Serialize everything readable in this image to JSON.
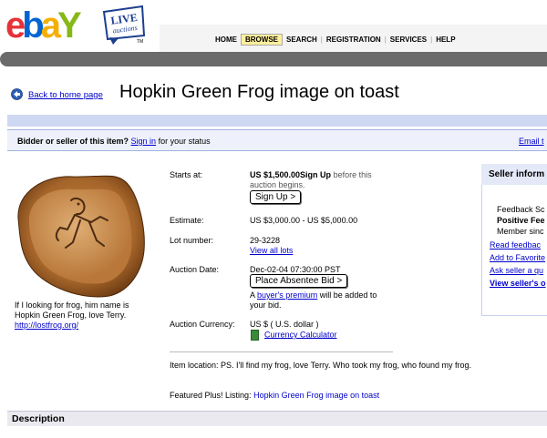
{
  "header": {
    "logo_letters": [
      "e",
      "b",
      "a",
      "Y"
    ],
    "logo_colors": [
      "#e53238",
      "#0064d2",
      "#f5af02",
      "#86b817"
    ],
    "live_badge": [
      "LIVE",
      "auctions"
    ],
    "live_tm": "TM",
    "nav": [
      "HOME",
      "BROWSE",
      "SEARCH",
      "REGISTRATION",
      "SERVICES",
      "HELP"
    ]
  },
  "title_row": {
    "back_link": "Back to home page",
    "title": "Hopkin Green Frog image on toast"
  },
  "status_bar": {
    "prefix": "Bidder or seller of this item?",
    "sign_in": "Sign in",
    "suffix": "for your status",
    "email": "Email t"
  },
  "item": {
    "caption_line1": "If I looking for frog, him name is",
    "caption_line2": "Hopkin Green Frog, love Terry.",
    "caption_url": "http://lostfrog.org/"
  },
  "details": {
    "starts_at_label": "Starts at:",
    "starts_at_value": "US $1,500.00",
    "sign_up_text": "Sign Up",
    "before_text_1": "before this",
    "before_text_2": "auction begins.",
    "sign_up_button": "Sign Up >",
    "estimate_label": "Estimate:",
    "estimate_value": "US $3,000.00 - US $5,000.00",
    "lot_label": "Lot number:",
    "lot_value": "29-3228",
    "view_lots": "View all lots",
    "date_label": "Auction Date:",
    "date_value": "Dec-02-04 07:30:00 PST",
    "absentee_button": "Place Absentee Bid >",
    "premium_prefix": "A",
    "premium_link": "buyer's premium",
    "premium_suffix": "will be added to",
    "premium_line2": "your bid.",
    "currency_label": "Auction Currency:",
    "currency_value": "US $ ( U.S. dollar )",
    "currency_calc": "Currency Calculator",
    "location": "Item location: PS. I'll find my frog, love Terry. Who took my frog, who found my frog.",
    "featured_label": "Featured Plus! Listing:",
    "featured_link": "Hopkin Green Frog image on toast"
  },
  "seller": {
    "heading": "Seller inform",
    "feedback": "Feedback Sc",
    "positive": "Positive Fee",
    "member": "Member sinc",
    "read_feedback": "Read feedbac",
    "add_fav": "Add to Favorite",
    "ask": "Ask seller a qu",
    "view_items": "View seller's o"
  },
  "description": {
    "heading": "Description"
  }
}
